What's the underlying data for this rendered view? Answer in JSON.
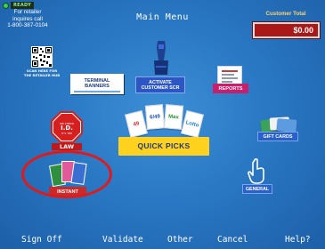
{
  "status": {
    "ready_text": "READY"
  },
  "retailer_info": {
    "line1": "For retailer",
    "line2": "inquires call",
    "phone": "1-800-387-0104"
  },
  "header": {
    "title": "Main Menu"
  },
  "customer_total": {
    "label": "Customer Total",
    "value": "$0.00"
  },
  "qr": {
    "label_line1": "SCAN HERE FOR",
    "label_line2": "THE RETAILER HUB"
  },
  "tiles": {
    "terminal_banners": {
      "line1": "TERMINAL",
      "line2": "BANNERS"
    },
    "activate_customer_scr": {
      "line1": "ACTIVATE",
      "line2": "CUSTOMER SCR"
    },
    "reports": {
      "label": "REPORTS"
    },
    "law": {
      "top": "WE CHECK",
      "id": "I.D.",
      "mid": "IT'S THE",
      "bottom": "LAW"
    },
    "quick_picks": {
      "label": "QUICK PICKS",
      "cards": [
        "49",
        "6/49",
        "Max",
        "Lotto"
      ]
    },
    "gift_cards": {
      "label": "GIFT CARDS"
    },
    "instant": {
      "label": "INSTANT"
    },
    "general": {
      "label": "GENERAL"
    }
  },
  "footer": {
    "sign_off": "Sign Off",
    "validate": "Validate",
    "other": "Other",
    "cancel": "Cancel",
    "help": "Help?"
  },
  "colors": {
    "background": "#2a78c4",
    "customer_total_box": "#aa1818",
    "instant_highlight": "#e01a1a",
    "quick_picks_label": "#ffd21f",
    "reports_label": "#c81f6c"
  }
}
